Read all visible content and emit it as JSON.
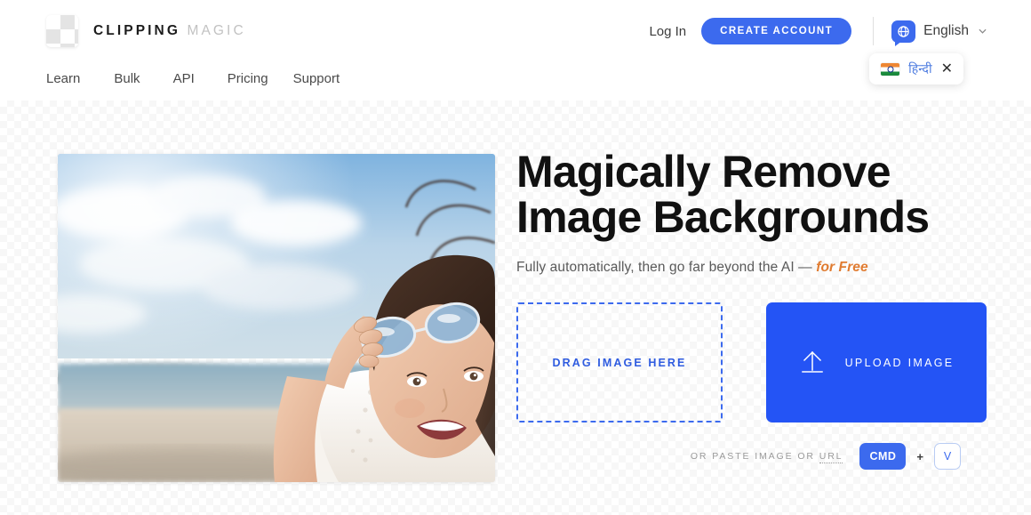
{
  "header": {
    "logo": {
      "icon": "checkerboard-logo-mark",
      "word_one": "CLIPPING",
      "word_two": "MAGIC"
    },
    "nav_items": [
      {
        "label": "Learn"
      },
      {
        "label": "Bulk"
      },
      {
        "label": "API"
      },
      {
        "label": "Pricing"
      },
      {
        "label": "Support"
      }
    ],
    "login_label": "Log In",
    "create_account_label": "CREATE ACCOUNT",
    "language": {
      "icon": "globe-icon",
      "current": "English",
      "caret": "⌄"
    },
    "language_suggestion": {
      "flag": "flag-india-icon",
      "label": "हिन्दी",
      "close": "✕"
    }
  },
  "hero": {
    "photo_alt": "smiling woman at the beach lifting sunglasses",
    "headline": "Magically Remove\nImage Backgrounds",
    "subhead_text": "Fully automatically, then go far beyond the AI — ",
    "subhead_highlight": "for Free",
    "drag_zone_label": "DRAG IMAGE HERE",
    "upload_button_label": "UPLOAD IMAGE",
    "upload_icon": "upload-arrow-icon",
    "paste_prefix": "OR PASTE IMAGE OR ",
    "paste_url_label": "URL",
    "key_cmd": "CMD",
    "key_join": "+",
    "key_v": "V"
  },
  "colors": {
    "brand_blue": "#2454f5",
    "button_blue": "#3c6aee",
    "accent_orange": "#e07b30",
    "text_dark": "#111111",
    "text_muted": "#9a9a9a"
  }
}
